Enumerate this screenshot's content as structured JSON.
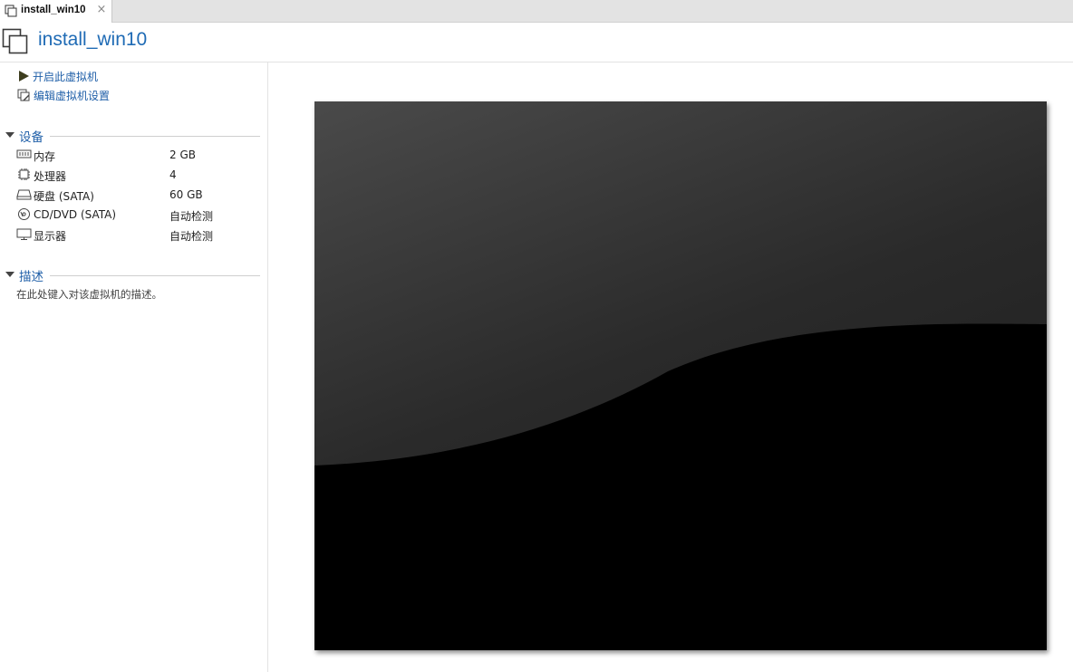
{
  "tab": {
    "label": "install_win10",
    "close_symbol": "×",
    "icon": "vm-window-icon"
  },
  "header": {
    "title": "install_win10",
    "icon": "vm-window-icon"
  },
  "actions": [
    {
      "label": "开启此虚拟机",
      "icon": "play-icon"
    },
    {
      "label": "编辑虚拟机设置",
      "icon": "edit-settings-icon"
    }
  ],
  "devices": {
    "title": "设备",
    "items": [
      {
        "name": "内存",
        "value": "2 GB",
        "icon": "memory-icon"
      },
      {
        "name": "处理器",
        "value": "4",
        "icon": "processor-icon"
      },
      {
        "name": "硬盘 (SATA)",
        "value": "60 GB",
        "icon": "hard-disk-icon"
      },
      {
        "name": "CD/DVD (SATA)",
        "value": "自动检测",
        "icon": "cd-dvd-icon"
      },
      {
        "name": "显示器",
        "value": "自动检测",
        "icon": "monitor-icon"
      }
    ]
  },
  "description": {
    "title": "描述",
    "placeholder": "在此处键入对该虚拟机的描述。"
  },
  "colors": {
    "link": "#1f5fa8",
    "title": "#1f6bb5",
    "play_icon": "#3a3a1a"
  }
}
